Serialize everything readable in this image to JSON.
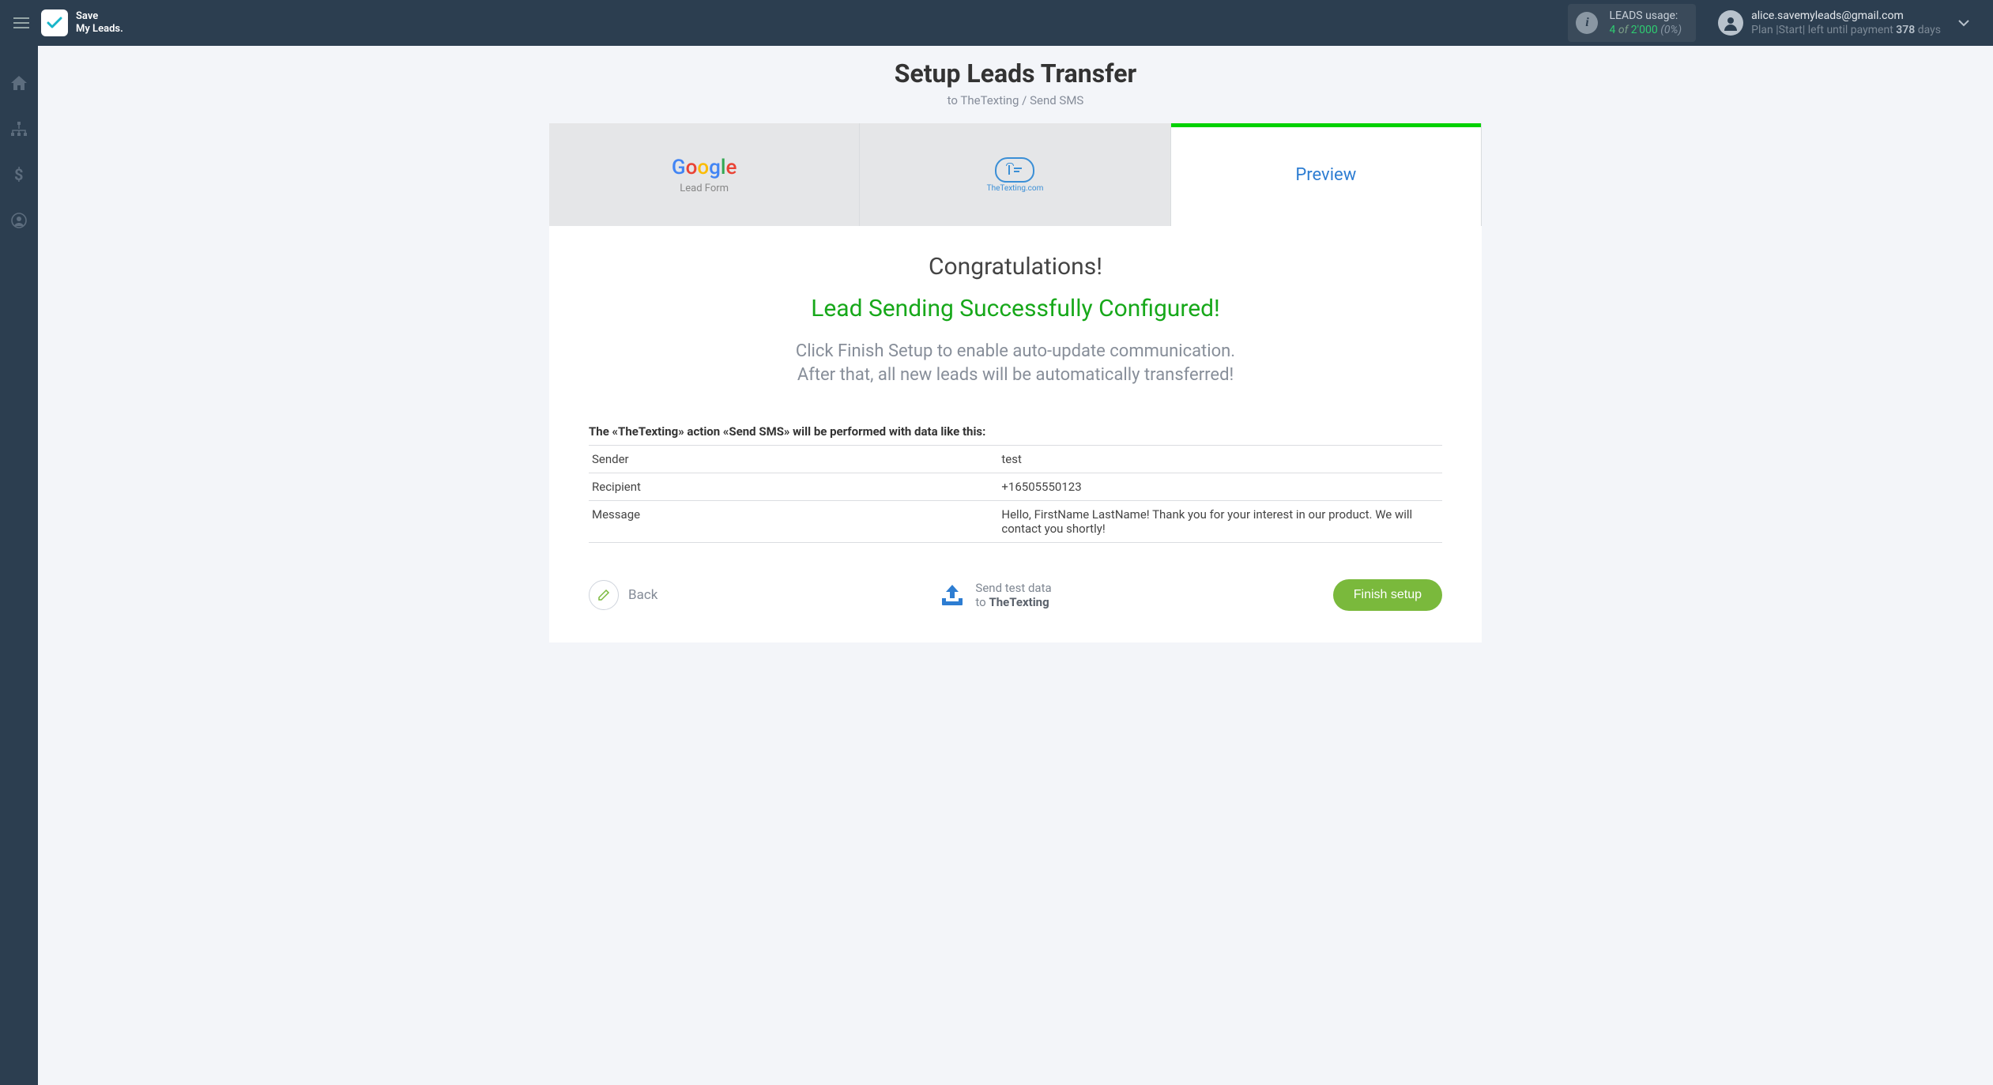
{
  "header": {
    "brand_line1": "Save",
    "brand_line2": "My Leads.",
    "usage": {
      "label": "LEADS usage:",
      "used": "4",
      "of_word": "of",
      "total": "2'000",
      "pct": "(0%)"
    },
    "account": {
      "email": "alice.savemyleads@gmail.com",
      "plan_prefix": "Plan |",
      "plan_name": "Start",
      "plan_mid": "| left until payment ",
      "days": "378",
      "days_suffix": " days"
    }
  },
  "page": {
    "title": "Setup Leads Transfer",
    "subtitle": "to TheTexting / Send SMS"
  },
  "tabs": {
    "source_caption": "Lead Form",
    "dest_caption": "TheTexting.com",
    "preview_label": "Preview"
  },
  "content": {
    "congrats": "Congratulations!",
    "success": "Lead Sending Successfully Configured!",
    "desc_line1": "Click Finish Setup to enable auto-update communication.",
    "desc_line2": "After that, all new leads will be automatically transferred!",
    "table_intro": "The «TheTexting» action «Send SMS» will be performed with data like this:",
    "rows": [
      {
        "k": "Sender",
        "v": "test"
      },
      {
        "k": "Recipient",
        "v": "+16505550123"
      },
      {
        "k": "Message",
        "v": "Hello, FirstName LastName! Thank you for your interest in our product. We will contact you shortly!"
      }
    ]
  },
  "footer": {
    "back": "Back",
    "test_line1": "Send test data",
    "test_line2_prefix": "to ",
    "test_line2_bold": "TheTexting",
    "finish": "Finish setup"
  }
}
